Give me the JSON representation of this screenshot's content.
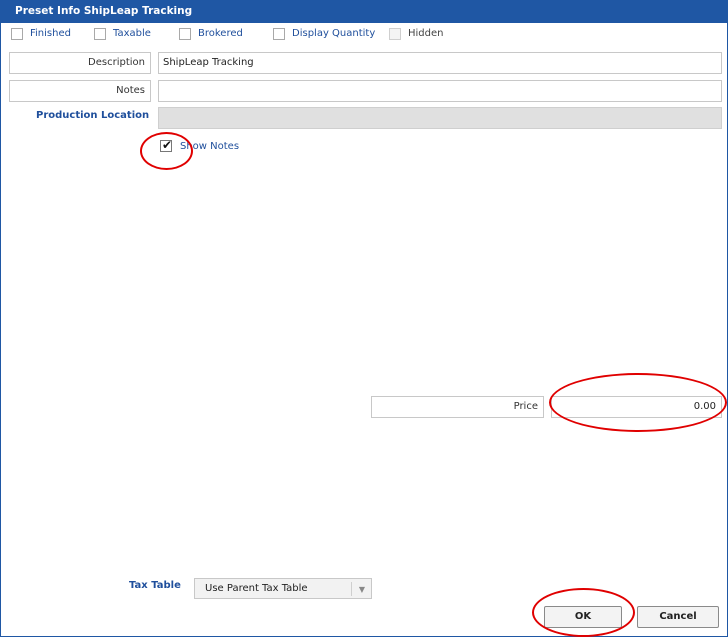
{
  "dialog": {
    "title": "Preset Info ShipLeap Tracking"
  },
  "checkboxes": [
    {
      "label": "Finished",
      "checked": false
    },
    {
      "label": "Taxable",
      "checked": false
    },
    {
      "label": "Brokered",
      "checked": false
    },
    {
      "label": "Display Quantity",
      "checked": false
    },
    {
      "label": "Hidden",
      "checked": false,
      "disabled": true
    }
  ],
  "fields": {
    "description": {
      "label": "Description",
      "value": "ShipLeap Tracking"
    },
    "notes": {
      "label": "Notes",
      "value": ""
    },
    "production_location": {
      "label": "Production Location",
      "value": ""
    }
  },
  "show_notes": {
    "label": "Show Notes",
    "checked": true
  },
  "price": {
    "label": "Price",
    "value": "0.00"
  },
  "tax_table": {
    "label": "Tax Table",
    "selected": "Use Parent Tax Table"
  },
  "buttons": {
    "ok": "OK",
    "cancel": "Cancel"
  },
  "colors": {
    "title_bar": "#1f57a4",
    "label_blue": "#1f4f9c",
    "annotation_red": "#e00000"
  }
}
